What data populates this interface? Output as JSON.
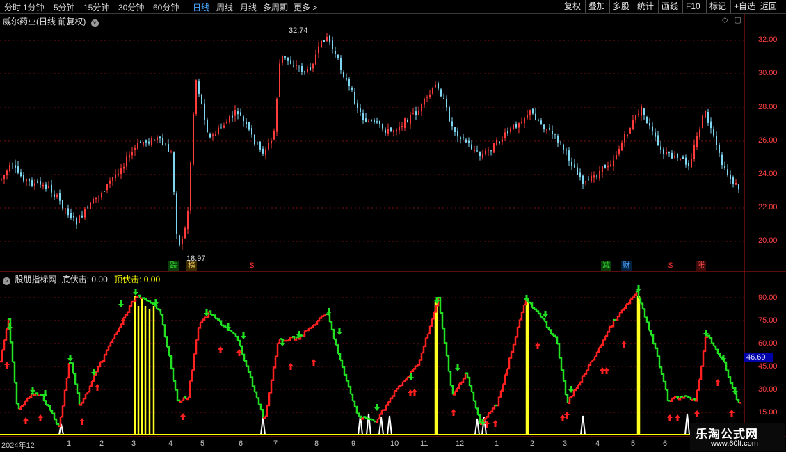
{
  "toolbar": {
    "periods": [
      "分时",
      "1分钟",
      "5分钟",
      "15分钟",
      "30分钟",
      "60分钟",
      "日线",
      "周线",
      "月线",
      "多周期",
      "更多 >"
    ],
    "active_period": "日线",
    "tools": [
      "复权",
      "叠加",
      "多股",
      "统计",
      "画线",
      "F10",
      "标记",
      "+自选",
      "返回"
    ]
  },
  "main_chart": {
    "title": "威尔药业(日线 前复权)",
    "price_axis": [
      "32.00",
      "30.00",
      "28.00",
      "26.00",
      "24.00",
      "22.00",
      "20.00"
    ],
    "high_label": "32.74",
    "low_label": "18.97",
    "badges": [
      {
        "text": "跌",
        "color": "#2fd22f",
        "bg": "#0a3d0a"
      },
      {
        "text": "榜",
        "color": "#e8c45a",
        "bg": "#3a2a00"
      },
      {
        "text": "$",
        "color": "#ff3030",
        "bg": "#000"
      },
      {
        "text": "减",
        "color": "#2fd22f",
        "bg": "#0a3d0a"
      },
      {
        "text": "财",
        "color": "#4aa4ff",
        "bg": "#00203d"
      },
      {
        "text": "$",
        "color": "#ff3030",
        "bg": "#000"
      },
      {
        "text": "涨",
        "color": "#ff5050",
        "bg": "#3d0a0a"
      }
    ],
    "up_color": "#ff3b3b",
    "down_color": "#7fd6f0"
  },
  "indicator": {
    "name": "股朋指标网",
    "bottom_label": "底伏击:",
    "bottom_value": "0.00",
    "top_label": "顶伏击:",
    "top_value": "0.00",
    "axis": [
      "90.00",
      "75.00",
      "60.00",
      "45.00",
      "30.00",
      "15.00"
    ],
    "current_value": "46.69"
  },
  "date_axis": [
    "2024年12",
    "1",
    "2",
    "3",
    "4",
    "5",
    "6",
    "7",
    "8",
    "9",
    "10",
    "11",
    "12",
    "1",
    "2",
    "3",
    "4",
    "5",
    "6"
  ],
  "watermark": {
    "title": "乐淘公式网",
    "url": "www.60lt.com"
  }
}
